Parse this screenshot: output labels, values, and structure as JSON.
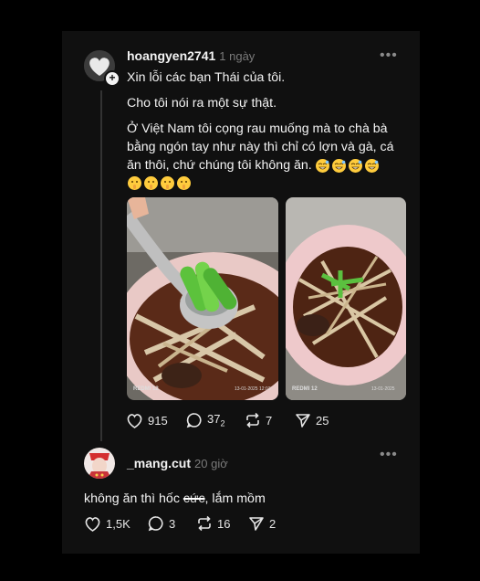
{
  "post": {
    "username": "hoangyen2741",
    "time": "1 ngày",
    "more": "•••",
    "lines": [
      "Xin lỗi các bạn Thái của tôi.",
      "Cho tôi nói ra một sự thật.",
      "Ở Việt Nam tôi cọng rau muống mà to chà bà",
      "bằng ngón tay như này thì chỉ có lợn và gà, cá",
      "ăn thôi, chứ chúng tôi không ăn."
    ],
    "emoji_row1": [
      "grin-sweat-emoji",
      "grin-sweat-emoji",
      "grin-sweat-emoji",
      "grin-sweat-emoji"
    ],
    "emoji_row2": [
      "shush-emoji",
      "shush-emoji",
      "shush-emoji",
      "shush-emoji"
    ],
    "photo1_watermark": "REDMI 12",
    "photo1_stamp": "13-01-2025 12:03",
    "photo2_watermark": "REDMI 12",
    "photo2_stamp": "13-01-2025",
    "likes": "915",
    "replies": "37",
    "replies_sub": "2",
    "reposts": "7",
    "shares": "25"
  },
  "reply": {
    "username": "_mang.cut",
    "time": "20 giờ",
    "more": "•••",
    "text_before": "không ăn thì hốc ",
    "text_struck": "cức",
    "text_after": ", lắm mồm",
    "likes": "1,5K",
    "replies": "3",
    "reposts": "16",
    "shares": "2"
  },
  "colors": {
    "background": "#000000",
    "panel": "#101010",
    "text": "#f3f3f3",
    "muted": "#7a7a7a"
  }
}
